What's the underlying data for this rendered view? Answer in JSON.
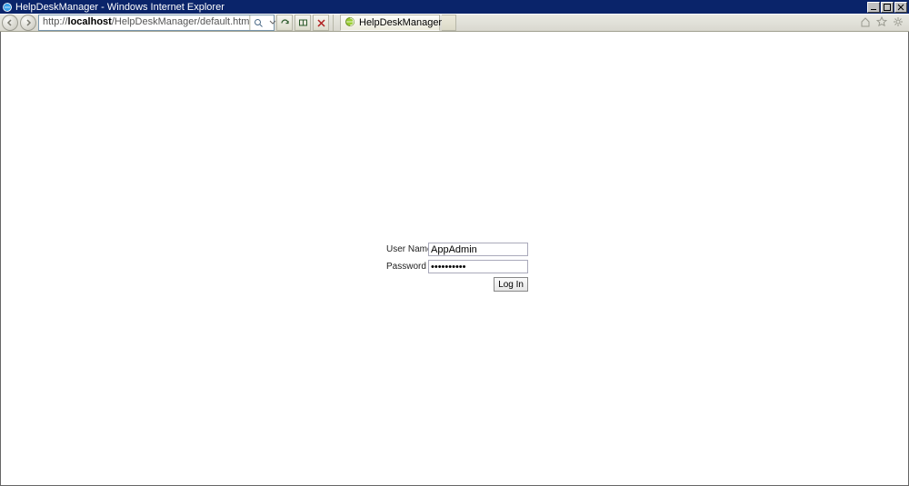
{
  "window": {
    "title": "HelpDeskManager - Windows Internet Explorer"
  },
  "address": {
    "url_prefix": "http://",
    "url_host": "localhost",
    "url_path": "/HelpDeskManager/default.htm"
  },
  "tab": {
    "title": "HelpDeskManager"
  },
  "login": {
    "username_label": "User Name",
    "username_value": "AppAdmin",
    "password_label": "Password",
    "password_value": "••••••••••",
    "submit_label": "Log In"
  }
}
